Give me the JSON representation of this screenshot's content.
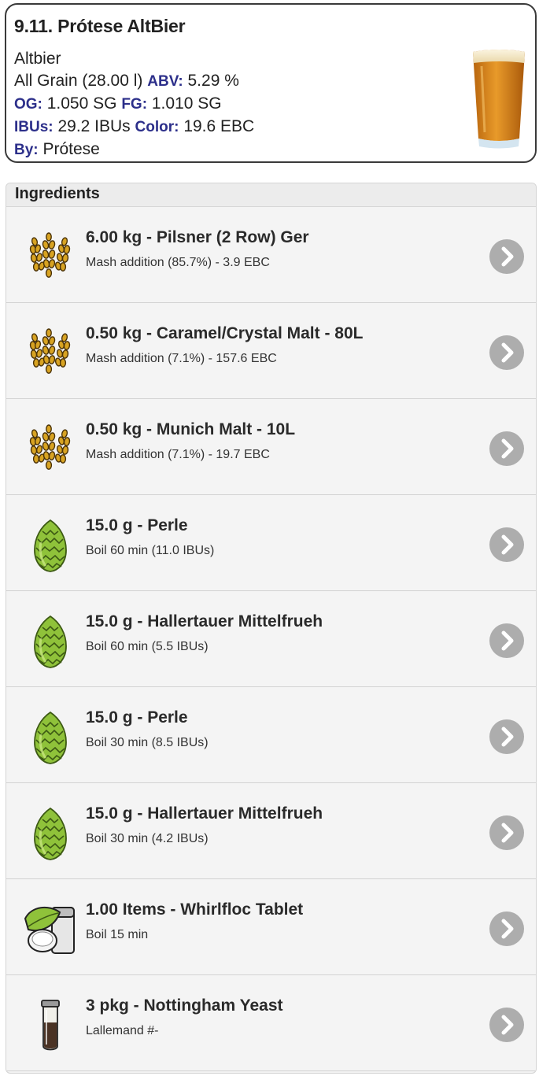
{
  "recipe": {
    "title": "9.11. Prótese AltBier",
    "style": "Altbier",
    "type_volume": "All Grain (28.00 l)",
    "abv_label": "ABV:",
    "abv_value": "5.29 %",
    "og_label": "OG:",
    "og_value": "1.050 SG",
    "fg_label": "FG:",
    "fg_value": "1.010 SG",
    "ibu_label": "IBUs:",
    "ibu_value": "29.2 IBUs",
    "color_label": "Color:",
    "color_value": "19.6 EBC",
    "by_label": "By:",
    "by_value": "Prótese",
    "glass_icon": "beer-glass-icon"
  },
  "ingredients": {
    "header": "Ingredients",
    "items": [
      {
        "icon": "grain-icon",
        "name": "6.00 kg - Pilsner (2 Row) Ger",
        "desc": "Mash addition (85.7%) - 3.9 EBC"
      },
      {
        "icon": "grain-icon",
        "name": "0.50 kg - Caramel/Crystal Malt - 80L",
        "desc": "Mash addition (7.1%) - 157.6 EBC"
      },
      {
        "icon": "grain-icon",
        "name": "0.50 kg - Munich Malt - 10L",
        "desc": "Mash addition (7.1%) - 19.7 EBC"
      },
      {
        "icon": "hop-icon",
        "name": "15.0 g - Perle",
        "desc": "Boil 60 min (11.0 IBUs)"
      },
      {
        "icon": "hop-icon",
        "name": "15.0 g - Hallertauer Mittelfrueh",
        "desc": "Boil 60 min (5.5 IBUs)"
      },
      {
        "icon": "hop-icon",
        "name": "15.0 g - Perle",
        "desc": "Boil 30 min (8.5 IBUs)"
      },
      {
        "icon": "hop-icon",
        "name": "15.0 g - Hallertauer Mittelfrueh",
        "desc": "Boil 30 min (4.2 IBUs)"
      },
      {
        "icon": "misc-icon",
        "name": "1.00 Items - Whirlfloc Tablet",
        "desc": "Boil 15 min"
      },
      {
        "icon": "yeast-icon",
        "name": "3 pkg - Nottingham Yeast",
        "desc": "Lallemand #-"
      }
    ]
  },
  "colors": {
    "label_blue": "#2c2f8a",
    "chevron_gray": "#adadad",
    "hop_green": "#8fc23a",
    "grain_gold": "#d8a322"
  }
}
